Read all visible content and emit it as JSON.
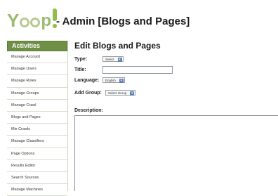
{
  "header": {
    "logo": {
      "brand": "Yoop!"
    },
    "title": "- Admin [Blogs and Pages]"
  },
  "sidebar": {
    "heading": "Activities",
    "items": [
      {
        "label": "Manage Account"
      },
      {
        "label": "Manage Users"
      },
      {
        "label": "Manage Roles"
      },
      {
        "label": "Manage Groups"
      },
      {
        "label": "Manage Crawl"
      },
      {
        "label": "Blogs and Pages"
      },
      {
        "label": "Mix Crawls"
      },
      {
        "label": "Manage Classifiers"
      },
      {
        "label": "Page Options"
      },
      {
        "label": "Results Editor"
      },
      {
        "label": "Search Sources"
      },
      {
        "label": "Manage Machines"
      }
    ]
  },
  "main": {
    "heading": "Edit Blogs and Pages",
    "form": {
      "type_label": "Type:",
      "type_value": "Select",
      "title_label": "Title:",
      "title_value": "",
      "language_label": "Language:",
      "language_value": "English",
      "add_group_label": "Add Group:",
      "add_group_value": "Select Group",
      "description_label": "Description:",
      "description_value": ""
    }
  },
  "colors": {
    "sidebar_heading_bg": "#6f8f45",
    "logo_green": "#8fbf4a"
  }
}
